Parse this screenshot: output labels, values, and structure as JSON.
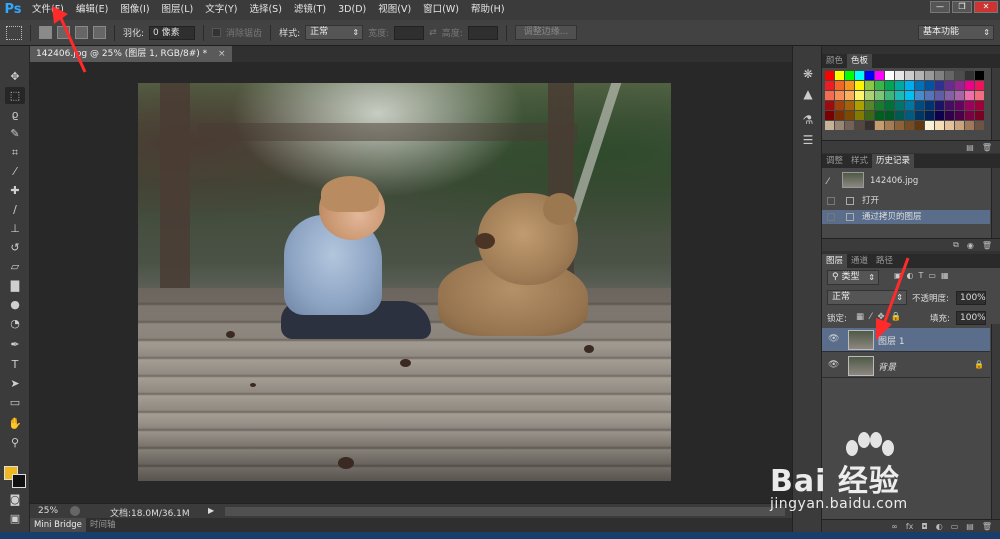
{
  "app": {
    "logo": "Ps"
  },
  "menu": [
    "文件(F)",
    "编辑(E)",
    "图像(I)",
    "图层(L)",
    "文字(Y)",
    "选择(S)",
    "滤镜(T)",
    "3D(D)",
    "视图(V)",
    "窗口(W)",
    "帮助(H)"
  ],
  "window_controls": {
    "minimize": "—",
    "restore": "❐",
    "close": "✕"
  },
  "options": {
    "feather_label": "羽化:",
    "feather_value": "0 像素",
    "antialias_label": "消除锯齿",
    "style_label": "样式:",
    "style_value": "正常",
    "width_label": "宽度:",
    "height_label": "高度:",
    "refine_edge_label": "调整边缘...",
    "workspace": "基本功能"
  },
  "document": {
    "tab_title": "142406.jpg @ 25% (图层 1, RGB/8#) *",
    "tab_close": "×",
    "zoom": "25%",
    "doc_size": "文档:18.0M/36.1M"
  },
  "bottom_tabs": {
    "mini_bridge": "Mini Bridge",
    "timeline": "时间轴"
  },
  "panels": {
    "color_tabs": [
      "颜色",
      "色板"
    ],
    "history_tabs": [
      "调整",
      "样式",
      "历史记录"
    ],
    "history_items": [
      {
        "label": "142406.jpg",
        "type": "snapshot"
      },
      {
        "label": "打开",
        "type": "step"
      },
      {
        "label": "通过拷贝的图层",
        "type": "step",
        "selected": true
      }
    ],
    "layers_tabs": [
      "图层",
      "通道",
      "路径"
    ],
    "layer_filter": "类型",
    "blend_mode": "正常",
    "opacity_label": "不透明度:",
    "opacity_value": "100%",
    "lock_label": "锁定:",
    "fill_label": "填充:",
    "fill_value": "100%",
    "layers": [
      {
        "name": "图层 1",
        "selected": true,
        "locked": false
      },
      {
        "name": "背景",
        "selected": false,
        "locked": true
      }
    ]
  },
  "watermark": {
    "text": "Bai 经验",
    "url": "jingyan.baidu.com"
  },
  "colors": {
    "accent_selected": "#5a6e8c",
    "foreground": "#f0b820",
    "background": "#111111",
    "annotation_arrow": "#ff2a2a"
  },
  "swatches": [
    "#ff0000",
    "#ffff00",
    "#00ff00",
    "#00ffff",
    "#0000ff",
    "#ff00ff",
    "#ffffff",
    "#e6e6e6",
    "#cccccc",
    "#b3b3b3",
    "#999999",
    "#808080",
    "#666666",
    "#4d4d4d",
    "#333333",
    "#000000",
    "#ed1c24",
    "#f26522",
    "#f7941d",
    "#fff200",
    "#8dc63f",
    "#39b54a",
    "#00a651",
    "#00a99d",
    "#00aeef",
    "#0072bc",
    "#0054a6",
    "#2e3192",
    "#662d91",
    "#92278f",
    "#ec008c",
    "#ed145b",
    "#f26c4f",
    "#f68e56",
    "#fbaf5d",
    "#fff568",
    "#acd373",
    "#7cc576",
    "#3bb878",
    "#1abbb4",
    "#00bff3",
    "#448ccb",
    "#5574b9",
    "#605ca8",
    "#8560a8",
    "#a864a8",
    "#f06eaa",
    "#f26d7d",
    "#9e0b0f",
    "#a0410d",
    "#a36209",
    "#aba000",
    "#598527",
    "#197b30",
    "#007236",
    "#00746b",
    "#0076a3",
    "#004b80",
    "#003471",
    "#1b1464",
    "#440e62",
    "#630460",
    "#9e005d",
    "#9e0039",
    "#790000",
    "#7b2e00",
    "#7d4900",
    "#827b00",
    "#406618",
    "#005e20",
    "#005826",
    "#005952",
    "#005b7f",
    "#003663",
    "#002157",
    "#0d004c",
    "#32004b",
    "#4b0049",
    "#7b0046",
    "#7a0026",
    "#c7b299",
    "#998675",
    "#736357",
    "#534741",
    "#37302d",
    "#c69c6d",
    "#a67c52",
    "#8c6239",
    "#754c24",
    "#603913",
    "#fbf0d9",
    "#f5deb3",
    "#e3c19c",
    "#c9a27e",
    "#a0785a",
    "#6d5343"
  ]
}
